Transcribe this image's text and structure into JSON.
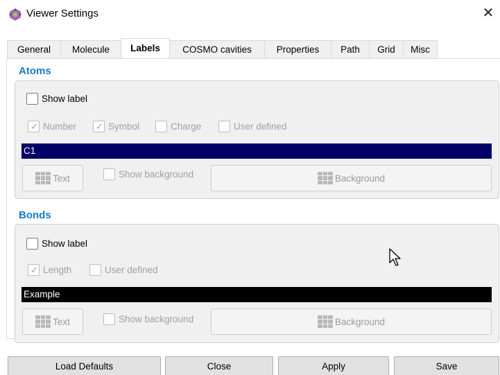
{
  "window": {
    "title": "Viewer Settings",
    "close_glyph": "✕"
  },
  "tabs": [
    {
      "label": "General"
    },
    {
      "label": "Molecule"
    },
    {
      "label": "Labels"
    },
    {
      "label": "COSMO cavities"
    },
    {
      "label": "Properties"
    },
    {
      "label": "Path"
    },
    {
      "label": "Grid"
    },
    {
      "label": "Misc"
    }
  ],
  "active_tab": "Labels",
  "atoms": {
    "title": "Atoms",
    "show_label": "Show label",
    "number": "Number",
    "symbol": "Symbol",
    "charge": "Charge",
    "user_defined": "User defined",
    "example_text": "C1",
    "example_bg": "#000066",
    "text_button": "Text",
    "show_background": "Show background",
    "background_button": "Background"
  },
  "bonds": {
    "title": "Bonds",
    "show_label": "Show label",
    "length": "Length",
    "user_defined": "User defined",
    "example_text": "Example",
    "example_bg": "#000000",
    "text_button": "Text",
    "show_background": "Show background",
    "background_button": "Background"
  },
  "buttons": {
    "load_defaults": "Load Defaults",
    "close": "Close",
    "apply": "Apply",
    "save": "Save"
  },
  "colors": {
    "accent": "#1979c9"
  },
  "checkmark": "✓"
}
